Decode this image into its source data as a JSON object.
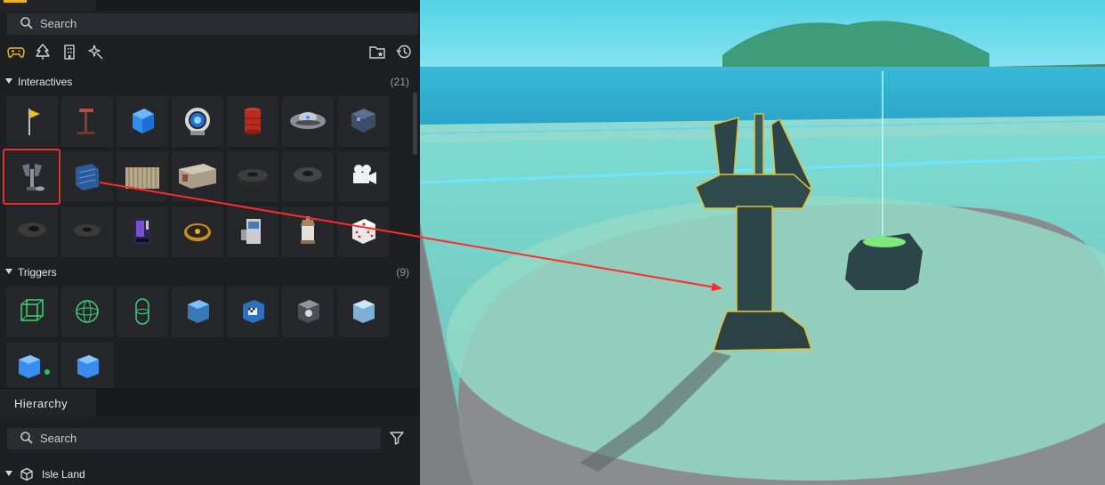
{
  "left_panel": {
    "search_placeholder": "Search",
    "toolbar": {
      "tab_icons": [
        "gamepad-icon",
        "tree-icon",
        "building-icon",
        "effects-icon"
      ],
      "right_icons": [
        "favorite-folder-icon",
        "history-icon"
      ],
      "active_accent": "#e8b227"
    },
    "interactives": {
      "label": "Interactives",
      "count": "(21)",
      "items": [
        "yellow-flag",
        "signpost",
        "blue-cube",
        "portal-ring",
        "red-barrel",
        "ufo-disc",
        "stone-block",
        "turret-tower",
        "blue-crate",
        "wooden-fence",
        "shipping-container",
        "tire-stack",
        "tire",
        "camera",
        "tire-black",
        "tire-small",
        "vending-machine",
        "gold-coin",
        "fuel-pump",
        "lantern",
        "dice"
      ]
    },
    "triggers": {
      "label": "Triggers",
      "count": "(9)",
      "items": [
        "box-trigger-green",
        "sphere-trigger",
        "capsule-trigger",
        "box-trigger-blue",
        "checkpoint-trigger",
        "glass-trigger",
        "ice-cube-trigger",
        "cube-trigger-dot",
        "cube-trigger-solid"
      ]
    },
    "selection_color": "#e5342a"
  },
  "hierarchy": {
    "title": "Hierarchy",
    "search_placeholder": "Search",
    "root_item": "Isle Land"
  },
  "viewport": {
    "arrow_color": "#ff2b2b"
  }
}
